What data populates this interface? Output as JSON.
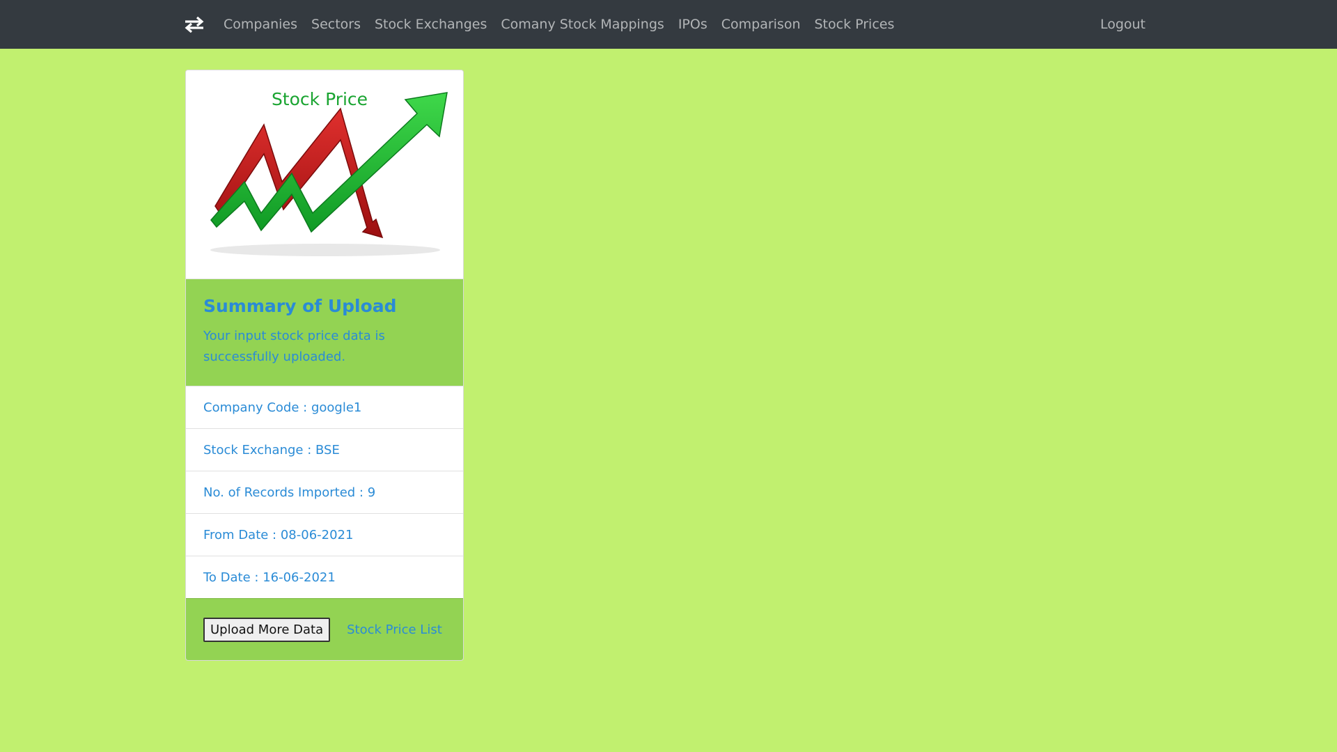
{
  "nav": {
    "brand_icon": "swap-arrows-icon",
    "items": [
      {
        "label": "Companies"
      },
      {
        "label": "Sectors"
      },
      {
        "label": "Stock Exchanges"
      },
      {
        "label": "Comany Stock Mappings"
      },
      {
        "label": "IPOs"
      },
      {
        "label": "Comparison"
      },
      {
        "label": "Stock Prices"
      }
    ],
    "logout_label": "Logout"
  },
  "card": {
    "image_caption": "Stock Price",
    "title": "Summary of Upload",
    "text": "Your input stock price data is successfully uploaded.",
    "details": [
      {
        "text": "Company Code : google1"
      },
      {
        "text": "Stock Exchange : BSE"
      },
      {
        "text": "No. of Records Imported : 9"
      },
      {
        "text": "From Date : 08-06-2021"
      },
      {
        "text": "To Date : 16-06-2021"
      }
    ],
    "upload_button_label": "Upload More Data",
    "list_link_label": "Stock Price List"
  },
  "colors": {
    "page_background": "#c1f06f",
    "navbar": "#343a40",
    "card_accent": "#93d353",
    "text_blue": "#2a8bd6"
  }
}
